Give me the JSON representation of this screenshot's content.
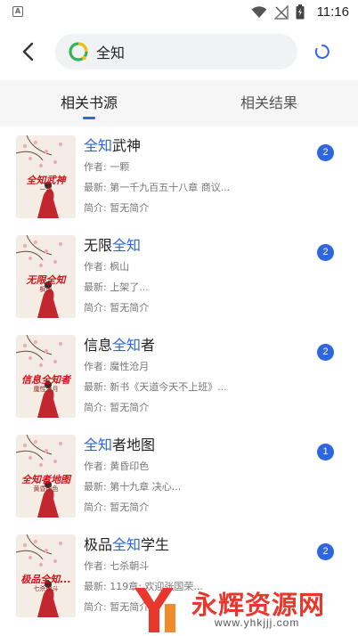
{
  "status_bar": {
    "sim_label": "A",
    "time": "11:16"
  },
  "search": {
    "value": "全知"
  },
  "tabs": [
    {
      "label": "相关书源",
      "active": true
    },
    {
      "label": "相关结果",
      "active": false
    }
  ],
  "books": [
    {
      "title_parts": [
        {
          "text": "全知",
          "hl": true
        },
        {
          "text": "武神",
          "hl": false
        }
      ],
      "author": "作者: 一颗",
      "latest": "最新: 第一千九百五十八章 商议...",
      "intro": "简介: 暂无简介",
      "count": "2",
      "cover_title": "全知武神",
      "cover_author": "一颗"
    },
    {
      "title_parts": [
        {
          "text": "无限",
          "hl": false
        },
        {
          "text": "全知",
          "hl": true
        }
      ],
      "author": "作者: 枫山",
      "latest": "最新: 上架了...",
      "intro": "简介: 暂无简介",
      "count": "2",
      "cover_title": "无限全知",
      "cover_author": "枫山"
    },
    {
      "title_parts": [
        {
          "text": "信息",
          "hl": false
        },
        {
          "text": "全知",
          "hl": true
        },
        {
          "text": "者",
          "hl": false
        }
      ],
      "author": "作者: 魔性沧月",
      "latest": "最新: 新书《天道今天不上班》...",
      "intro": "简介: 暂无简介",
      "count": "2",
      "cover_title": "信息全知者",
      "cover_author": "魔性沧月"
    },
    {
      "title_parts": [
        {
          "text": "全知",
          "hl": true
        },
        {
          "text": "者地图",
          "hl": false
        }
      ],
      "author": "作者: 黄昏印色",
      "latest": "最新: 第十九章 决心...",
      "intro": "简介: 暂无简介",
      "count": "1",
      "cover_title": "全知者地图",
      "cover_author": "黄昏印色"
    },
    {
      "title_parts": [
        {
          "text": "极品",
          "hl": false
        },
        {
          "text": "全知",
          "hl": true
        },
        {
          "text": "学生",
          "hl": false
        }
      ],
      "author": "作者: 七杀朝斗",
      "latest": "最新: 119章: 欢迎张国荣...",
      "intro": "简介: 暂无简介",
      "count": "2",
      "cover_title": "极品全知...",
      "cover_author": "七杀朝斗"
    }
  ],
  "watermark": {
    "text": "永辉资源网",
    "url": "www.yhkjjj.com"
  },
  "colors": {
    "accent": "#2f66e0",
    "cover_red": "#d3121b",
    "watermark_red": "#e8382d"
  }
}
